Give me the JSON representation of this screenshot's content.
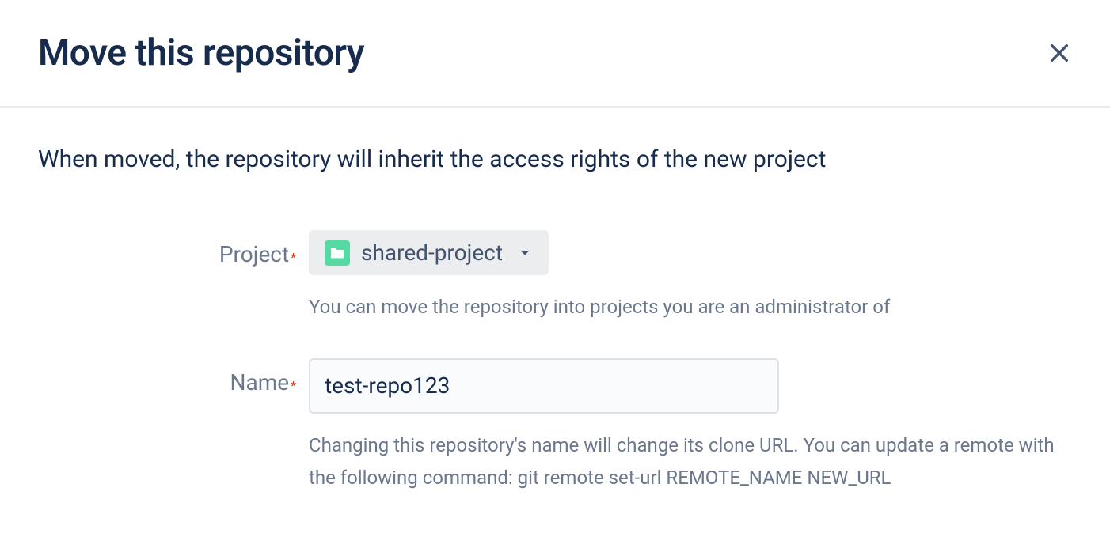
{
  "dialog": {
    "title": "Move this repository",
    "description": "When moved, the repository will inherit the access rights of the new project"
  },
  "form": {
    "project": {
      "label": "Project",
      "selected_value": "shared-project",
      "help_text": "You can move the repository into projects you are an administrator of"
    },
    "name": {
      "label": "Name",
      "value": "test-repo123",
      "help_text": "Changing this repository's name will change its clone URL. You can update a remote with the following command: git remote set-url REMOTE_NAME NEW_URL"
    },
    "required_indicator": "*"
  }
}
